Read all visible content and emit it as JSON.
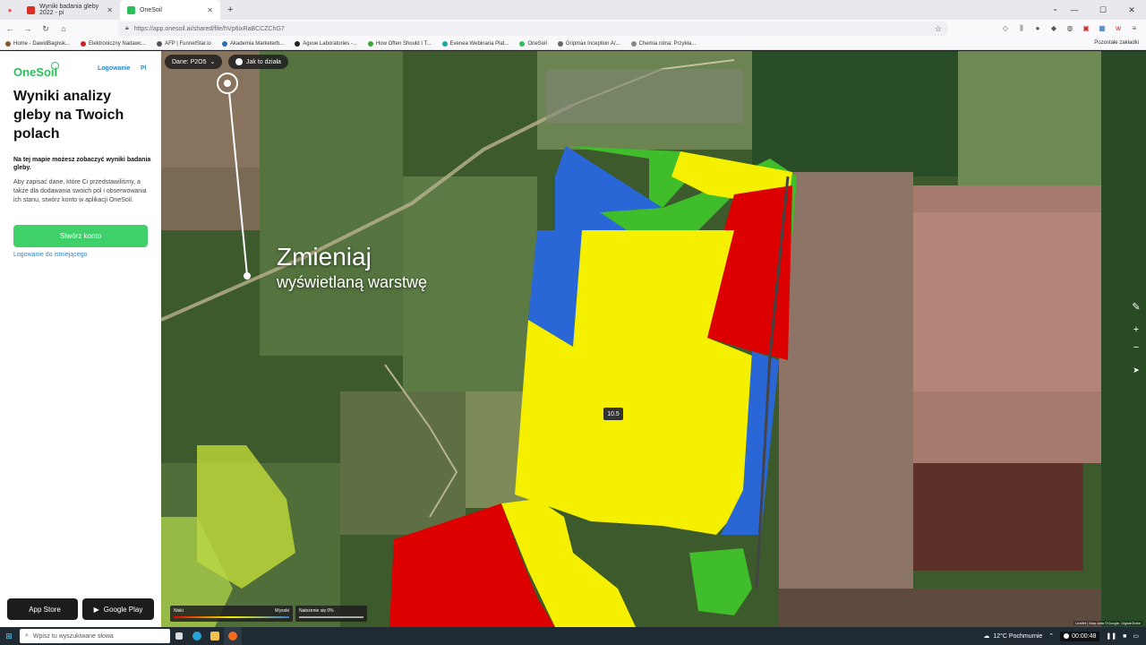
{
  "browser": {
    "tabs": [
      {
        "title": "Wyniki badania gleby 2022 - pi",
        "icon": "gmail-icon",
        "color": "#d93025"
      },
      {
        "title": "OneSoil",
        "icon": "onesoil-icon",
        "color": "#2ebd5b"
      }
    ],
    "new_tab": "+",
    "url": "https://app.onesoil.ai/shared/file/hVp6ixRaBCCZChG7"
  },
  "bookmarks": [
    {
      "label": "Home - DawidBagnsk...",
      "color": "#8a5a2b"
    },
    {
      "label": "Elektroniczny Nadawc...",
      "color": "#cc2222"
    },
    {
      "label": "AFP | FunnelStar.io",
      "color": "#555555"
    },
    {
      "label": "Akademia Marketerb...",
      "color": "#2a6fb5"
    },
    {
      "label": "Agvue Laboratories -...",
      "color": "#222222"
    },
    {
      "label": "How Often Should I T...",
      "color": "#3aaa35"
    },
    {
      "label": "Evenea Webinaria Plat...",
      "color": "#1aa9a0"
    },
    {
      "label": "OneSoil",
      "color": "#2ebd5b"
    },
    {
      "label": "Gripmax Inception A/...",
      "color": "#666666"
    },
    {
      "label": "Chemia rolna: Przykła...",
      "color": "#888888"
    }
  ],
  "bookmarks_other": "Pozostałe zakładki",
  "sidebar": {
    "logo": "OneSoil",
    "login": "Logowanie",
    "lang": "Pl",
    "title": "Wyniki analizy gleby na Twoich polach",
    "subtitle": "Na tej mapie możesz zobaczyć wyniki badania gleby.",
    "body": "Aby zapisać dane, które Ci przedstawiliśmy, a także dla dodawania swoich pól i obserwowania ich stanu, stwórz konto w aplikacji OneSoil.",
    "create_account": "Stwórz konto",
    "login_existing": "Logowanie do istniejącego",
    "app_store": "App Store",
    "google_play": "Google Play"
  },
  "map": {
    "data_chip": "Dane: P2O5",
    "how_chip": "Jak to działa",
    "overlay_title": "Zmieniaj",
    "overlay_subtitle": "wyświetlaną warstwę",
    "value_label": "10.5",
    "legend_low": "Niski",
    "legend_high": "Wysoki",
    "opacity_label": "Nałożenie się 0%",
    "attribution": "Leaflet | Map data ©Google, DigitalGlobe",
    "colors": {
      "low": "#dd0000",
      "mid": "#f5f000",
      "high": "#2f6fd6",
      "green": "#3fbd2a"
    }
  },
  "taskbar": {
    "search_placeholder": "Wpisz tu wyszukiwane słowa",
    "weather": "12°C Pochmurnie",
    "rec_time": "00:00:48"
  }
}
